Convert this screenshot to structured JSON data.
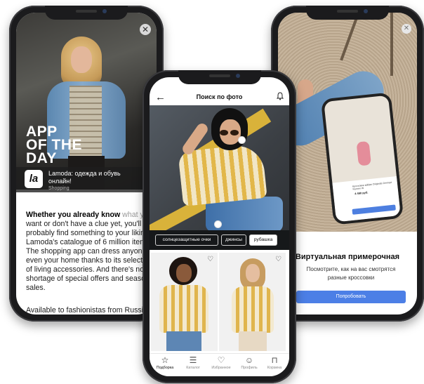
{
  "left_phone": {
    "badge_lines": [
      "APP",
      "OF THE",
      "DAY"
    ],
    "app_logo": "la",
    "app_name": "Lamoda: одежда и обувь онлайн!",
    "app_category": "Shopping",
    "article_bold": "Whether you already know",
    "article_fade": " what you",
    "article_rest": "want or don't have a clue yet, you'll probably find something to your liking in Lamoda's catalogue of 6 million items. The shopping app can dress anyone, even your home thanks to its selection of living accessories. And there's no shortage of special offers and seasonal sales.",
    "article2": "Available to fashionistas from Russia,"
  },
  "center_phone": {
    "title": "Поиск по фото",
    "chips": [
      {
        "label": "солнцезащитные очки",
        "active": false
      },
      {
        "label": "джинсы",
        "active": false
      },
      {
        "label": "рубашка",
        "active": true
      }
    ],
    "tabs": [
      {
        "label": "Подборка",
        "icon": "star-icon",
        "active": true
      },
      {
        "label": "Каталог",
        "icon": "catalog-search-icon",
        "active": false
      },
      {
        "label": "Избранное",
        "icon": "heart-icon",
        "active": false
      },
      {
        "label": "Профиль",
        "icon": "smiley-icon",
        "active": false
      },
      {
        "label": "Корзина",
        "icon": "bag-icon",
        "active": false
      }
    ]
  },
  "right_phone": {
    "title": "Виртуальная примерочная",
    "subtitle": "Посмотрите, как на вас смотрятся разные кроссовки",
    "button": "Попробовать",
    "mini_text": "Кроссовки adidas Originals Deerupt Runner W",
    "mini_price": "4 490 руб.",
    "mini_button": "Добавить в корзину"
  },
  "colors": {
    "accent_blue": "#4c7fe6",
    "stripe_yellow": "#e0b54d",
    "phone_frame": "#1b1b1d"
  }
}
